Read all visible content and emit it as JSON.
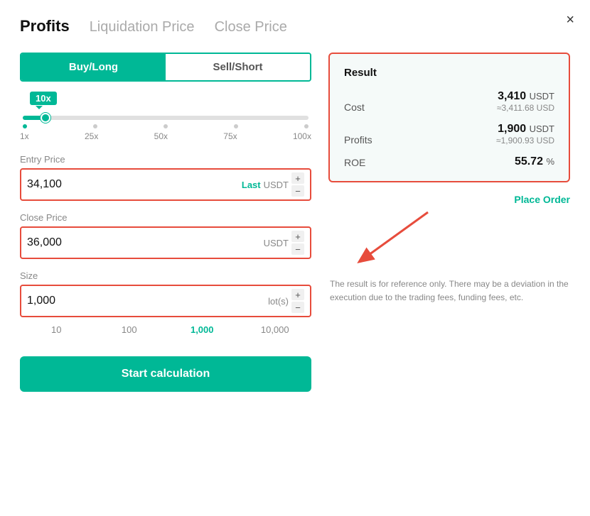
{
  "modal": {
    "close_label": "×"
  },
  "tabs": {
    "active": "Profits",
    "items": [
      {
        "label": "Profits",
        "active": true
      },
      {
        "label": "Liquidation Price",
        "active": false
      },
      {
        "label": "Close Price",
        "active": false
      }
    ]
  },
  "toggle": {
    "buy_label": "Buy/Long",
    "sell_label": "Sell/Short"
  },
  "leverage": {
    "badge": "10x",
    "marks": [
      "1x",
      "25x",
      "50x",
      "75x",
      "100x"
    ]
  },
  "entry_price": {
    "label": "Entry Price",
    "value": "34,100",
    "last_label": "Last",
    "unit": "USDT"
  },
  "close_price": {
    "label": "Close Price",
    "value": "36,000",
    "unit": "USDT"
  },
  "size": {
    "label": "Size",
    "value": "1,000",
    "unit": "lot(s)",
    "picks": [
      "10",
      "100",
      "1,000",
      "10,000"
    ]
  },
  "start_btn": "Start calculation",
  "result": {
    "title": "Result",
    "cost_label": "Cost",
    "cost_value": "3,410",
    "cost_unit": "USDT",
    "cost_sub": "≈3,411.68 USD",
    "profits_label": "Profits",
    "profits_value": "1,900",
    "profits_unit": "USDT",
    "profits_sub": "≈1,900.93 USD",
    "roe_label": "ROE",
    "roe_value": "55.72",
    "roe_unit": "%",
    "place_order": "Place Order"
  },
  "disclaimer": "The result is for reference only. There may be a deviation in the execution due to the trading fees, funding fees, etc."
}
